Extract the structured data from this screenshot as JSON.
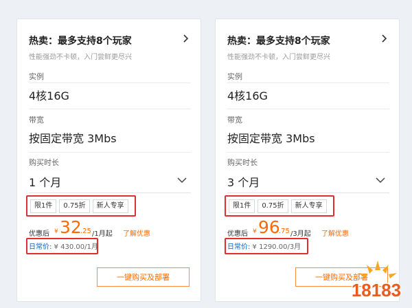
{
  "cards": [
    {
      "title": "热卖：最多支持8个玩家",
      "subtitle": "性能强劲不卡顿，入门尝鲜更尽兴",
      "instance_label": "实例",
      "instance_value": "4核16G",
      "bandwidth_label": "带宽",
      "bandwidth_value": "按固定带宽 3Mbs",
      "duration_label": "购买时长",
      "duration_value": "1 个月",
      "tags": [
        "限1件",
        "0.75折",
        "新人专享"
      ],
      "price_prefix": "优惠后",
      "currency": "¥",
      "price_int": "32",
      "price_dec": ".25",
      "price_unit": "/1月起",
      "learn_more": "了解优惠",
      "regular_label": "日常价:",
      "regular_value": " ¥ 430.00/1月",
      "buy_button": "一键购买及部署"
    },
    {
      "title": "热卖：最多支持8个玩家",
      "subtitle": "性能强劲不卡顿，入门尝鲜更尽兴",
      "instance_label": "实例",
      "instance_value": "4核16G",
      "bandwidth_label": "带宽",
      "bandwidth_value": "按固定带宽 3Mbs",
      "duration_label": "购买时长",
      "duration_value": "3 个月",
      "tags": [
        "限1件",
        "0.75折",
        "新人专享"
      ],
      "price_prefix": "优惠后",
      "currency": "¥",
      "price_int": "96",
      "price_dec": ".75",
      "price_unit": "/3月起",
      "learn_more": "了解优惠",
      "regular_label": "日常价:",
      "regular_value": " ¥ 1290.00/3月",
      "buy_button": "一键购买及部署"
    }
  ],
  "watermark": {
    "text": "18183"
  },
  "colors": {
    "accent": "#ff6a00",
    "highlight_box": "#e02d2d",
    "regular_price_label": "#0066cc"
  }
}
